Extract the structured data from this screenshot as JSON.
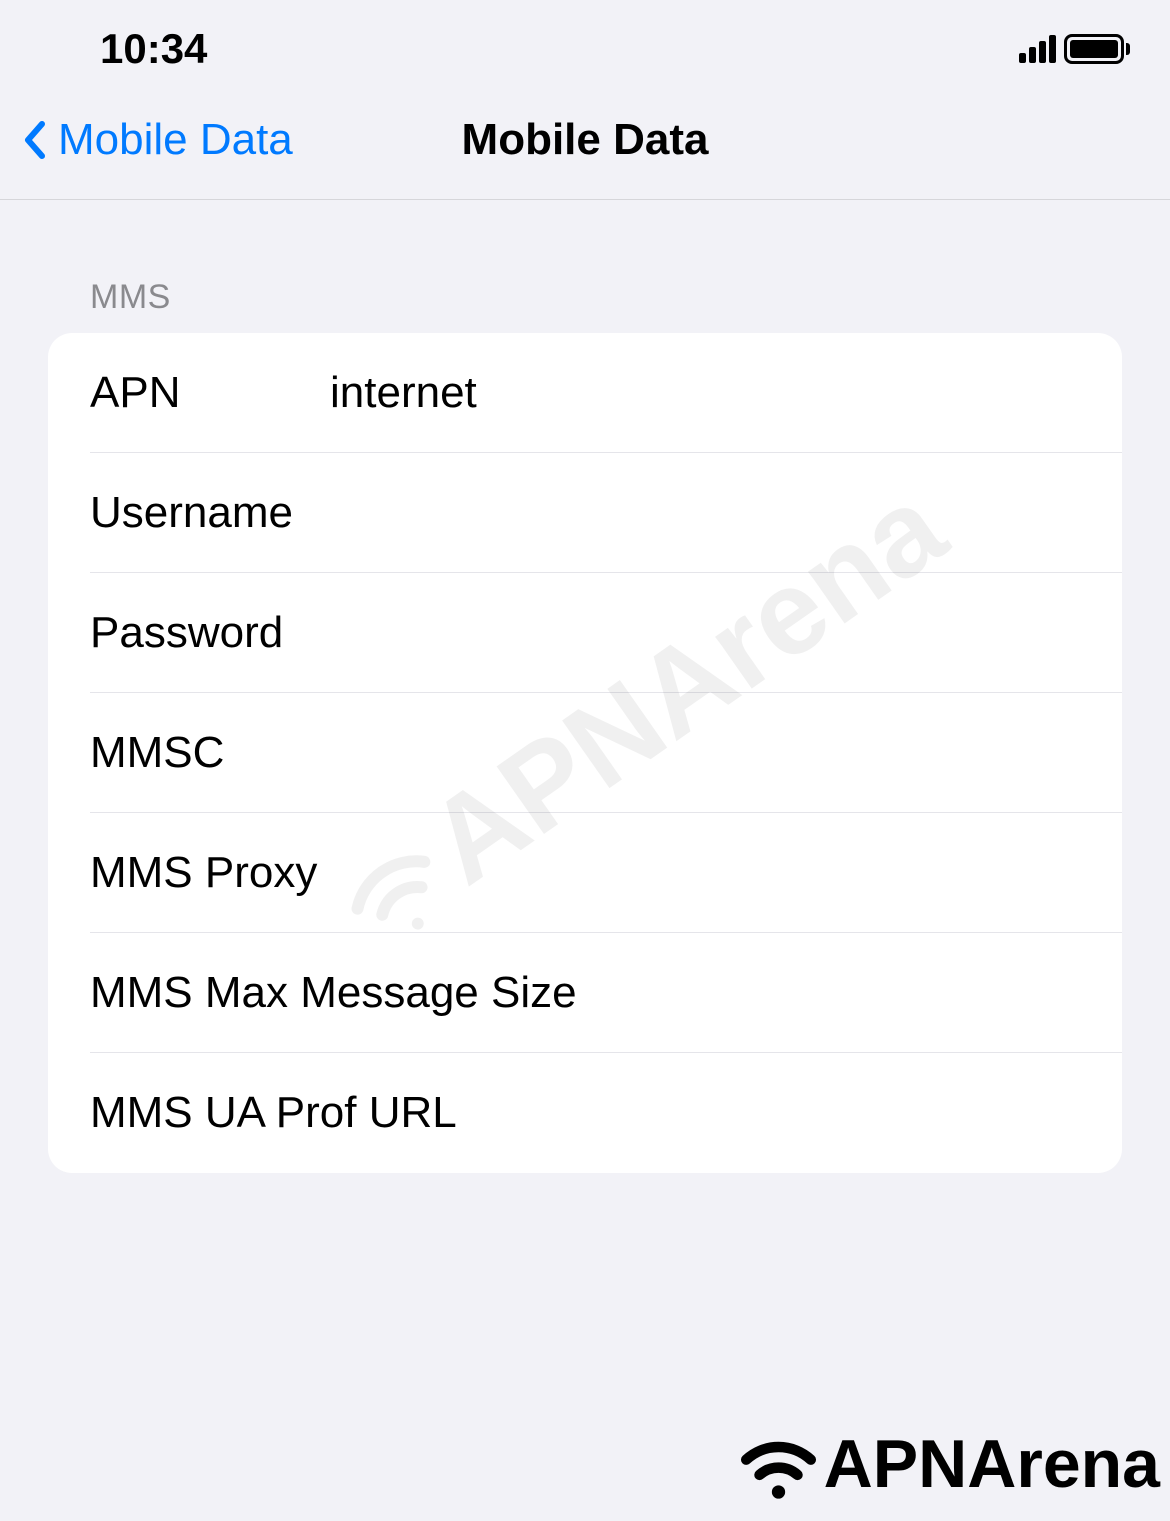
{
  "statusBar": {
    "time": "10:34"
  },
  "nav": {
    "backLabel": "Mobile Data",
    "title": "Mobile Data"
  },
  "section": {
    "header": "MMS"
  },
  "fields": {
    "apn": {
      "label": "APN",
      "value": "internet"
    },
    "username": {
      "label": "Username",
      "value": ""
    },
    "password": {
      "label": "Password",
      "value": ""
    },
    "mmsc": {
      "label": "MMSC",
      "value": ""
    },
    "mmsProxy": {
      "label": "MMS Proxy",
      "value": ""
    },
    "mmsMax": {
      "label": "MMS Max Message Size",
      "value": ""
    },
    "mmsUa": {
      "label": "MMS UA Prof URL",
      "value": ""
    }
  },
  "watermark": {
    "text": "APNArena"
  },
  "footerLogo": {
    "text": "APNArena"
  }
}
